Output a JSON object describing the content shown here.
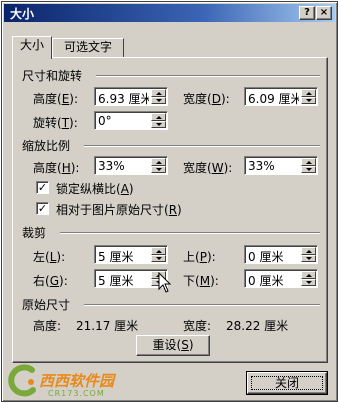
{
  "window": {
    "title": "大小",
    "help_glyph": "?",
    "close_glyph": "×"
  },
  "tabs": [
    {
      "label": "大小"
    },
    {
      "label": "可选文字"
    }
  ],
  "size_rotate": {
    "heading": "尺寸和旋转",
    "height_label": "高度",
    "height_key": "E",
    "height_value": "6.93 厘米",
    "width_label": "宽度",
    "width_key": "D",
    "width_value": "6.09 厘米",
    "rotate_label": "旋转",
    "rotate_key": "T",
    "rotate_value": "0°"
  },
  "scale": {
    "heading": "缩放比例",
    "height_label": "高度",
    "height_key": "H",
    "height_value": "33%",
    "width_label": "宽度",
    "width_key": "W",
    "width_value": "33%",
    "lock_label": "锁定纵横比",
    "lock_key": "A",
    "lock_checked": true,
    "relative_label": "相对于图片原始尺寸",
    "relative_key": "R",
    "relative_checked": true
  },
  "crop": {
    "heading": "裁剪",
    "left_label": "左",
    "left_key": "L",
    "left_value": "5 厘米",
    "top_label": "上",
    "top_key": "P",
    "top_value": "0 厘米",
    "right_label": "右",
    "right_key": "G",
    "right_value": "5 厘米",
    "bottom_label": "下",
    "bottom_key": "M",
    "bottom_value": "0 厘米"
  },
  "original": {
    "heading": "原始尺寸",
    "height_label": "高度:",
    "height_value": "21.17 厘米",
    "width_label": "宽度:",
    "width_value": "28.22 厘米",
    "reset_label": "重设",
    "reset_key": "S"
  },
  "footer": {
    "close_label": "关闭"
  },
  "watermark": {
    "name": "西西软件园",
    "sub": "CR173.COM"
  },
  "colors": {
    "face": "#d4d0c8",
    "title_start": "#0a246a",
    "title_end": "#a6caf0",
    "logo_orange": "#e88a1a",
    "logo_green": "#7aa83a"
  },
  "icons": [
    "help-icon",
    "close-icon",
    "spin-up-icon",
    "spin-down-icon",
    "check-icon",
    "mouse-cursor-icon",
    "watermark-logo"
  ]
}
